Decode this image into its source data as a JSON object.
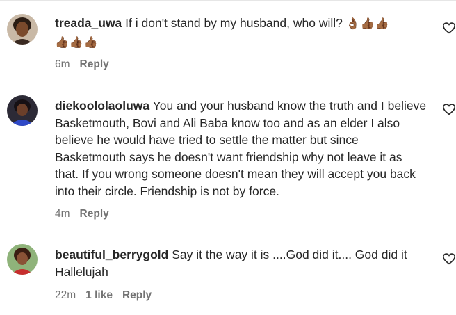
{
  "comments": [
    {
      "username": "treada_uwa",
      "text": "If i don't stand by my husband, who will?",
      "emoji_line1": "👌🏾👍🏾👍🏾",
      "emoji_line2": "👍🏾👍🏾👍🏾",
      "time": "6m",
      "likes": "",
      "reply_label": "Reply"
    },
    {
      "username": "diekoololaoluwa",
      "text": "You and your husband know the truth and I believe Basketmouth, Bovi and Ali Baba know too and as an elder I also believe he would have tried to settle the matter but since Basketmouth says he doesn't want friendship why not leave it as that. If you wrong someone doesn't mean they will accept you back into their circle. Friendship is not by force.",
      "time": "4m",
      "likes": "",
      "reply_label": "Reply"
    },
    {
      "username": "beautiful_berrygold",
      "text": "Say it the way it is ....God did it.... God did it Hallelujah",
      "time": "22m",
      "likes": "1 like",
      "reply_label": "Reply"
    }
  ],
  "icons": {
    "like": "heart-outline-icon"
  },
  "colors": {
    "text": "#262626",
    "meta": "#737373",
    "rule": "#e6e6e6"
  }
}
